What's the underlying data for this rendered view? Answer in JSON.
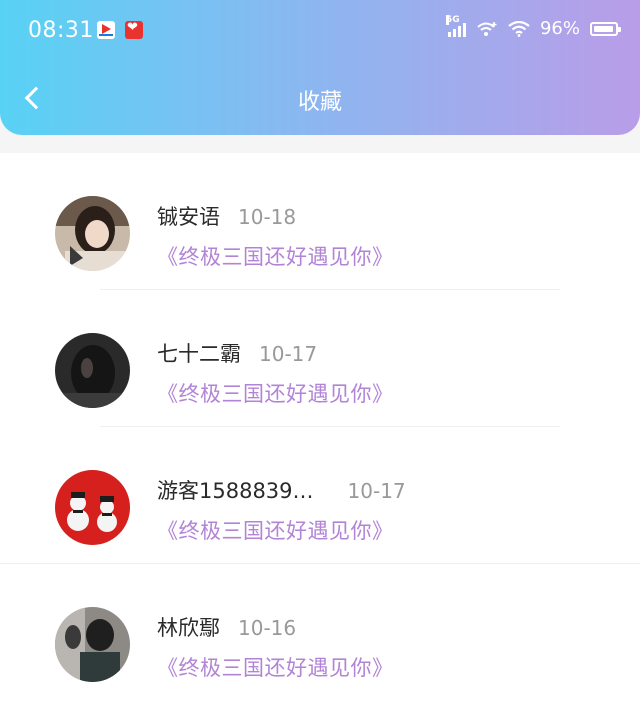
{
  "status_bar": {
    "time": "08:31",
    "network": "5G",
    "battery": "96%"
  },
  "header": {
    "title": "收藏",
    "back_icon": "chevron-left-icon"
  },
  "items": [
    {
      "name": "铖安语",
      "date": "10-18",
      "novel": "《终极三国还好遇见你》"
    },
    {
      "name": "七十二霸",
      "date": "10-17",
      "novel": "《终极三国还好遇见你》"
    },
    {
      "name": "游客1588839…",
      "date": "10-17",
      "novel": "《终极三国还好遇见你》"
    },
    {
      "name": "林欣鄢",
      "date": "10-16",
      "novel": "《终极三国还好遇见你》"
    }
  ],
  "colors": {
    "header_gradient_start": "#58d2f4",
    "header_gradient_end": "#b99de8",
    "novel_text": "#b284d6"
  }
}
